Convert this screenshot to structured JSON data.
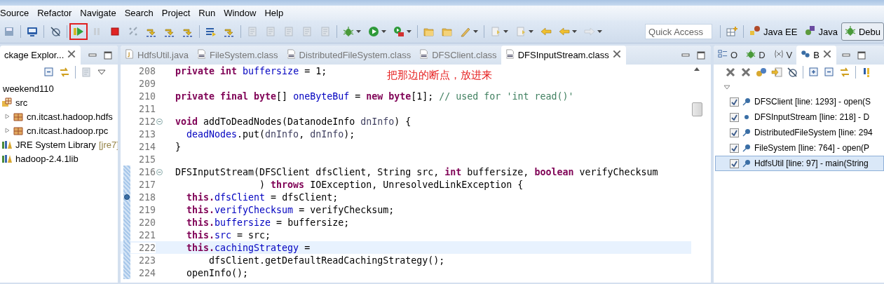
{
  "menu": [
    "Source",
    "Refactor",
    "Navigate",
    "Search",
    "Project",
    "Run",
    "Window",
    "Help"
  ],
  "toolbar": [
    {
      "kind": "disk"
    },
    {
      "kind": "sep"
    },
    {
      "kind": "monitor"
    },
    {
      "kind": "sep"
    },
    {
      "kind": "skip"
    },
    {
      "kind": "sep"
    },
    {
      "kind": "resume",
      "highlighted": true
    },
    {
      "kind": "pause"
    },
    {
      "kind": "stop"
    },
    {
      "kind": "unlink"
    },
    {
      "kind": "step"
    },
    {
      "kind": "step"
    },
    {
      "kind": "step"
    },
    {
      "kind": "sep"
    },
    {
      "kind": "list"
    },
    {
      "kind": "step"
    },
    {
      "kind": "sep"
    },
    {
      "kind": "gray"
    },
    {
      "kind": "gray"
    },
    {
      "kind": "gray"
    },
    {
      "kind": "gray"
    },
    {
      "kind": "gray"
    },
    {
      "kind": "sep"
    },
    {
      "kind": "bug",
      "dropdown": true
    },
    {
      "kind": "run",
      "dropdown": true
    },
    {
      "kind": "tools",
      "dropdown": true
    },
    {
      "kind": "sep"
    },
    {
      "kind": "folder"
    },
    {
      "kind": "folder"
    },
    {
      "kind": "pencil",
      "dropdown": true
    },
    {
      "kind": "sep"
    },
    {
      "kind": "page",
      "dropdown": true
    },
    {
      "kind": "page",
      "dropdown": true
    },
    {
      "kind": "back"
    },
    {
      "kind": "back",
      "dropdown": true
    },
    {
      "kind": "forward",
      "dropdown": true
    }
  ],
  "quick_access": {
    "placeholder": "Quick Access"
  },
  "perspectives": [
    {
      "label": "Java EE",
      "selected": false
    },
    {
      "label": "Java",
      "selected": false
    },
    {
      "label": "Debu",
      "selected": true
    }
  ],
  "package_explorer": {
    "title": "ckage Explor...",
    "toolbar": [
      {
        "kind": "collapse"
      },
      {
        "kind": "sync"
      },
      {
        "kind": "sep"
      },
      {
        "kind": "gray"
      },
      {
        "kind": "menu"
      }
    ],
    "tree": [
      {
        "label": "weekend110",
        "children": [
          {
            "label": "src",
            "kind": "source",
            "children": [
              {
                "label": "cn.itcast.hadoop.hdfs",
                "kind": "package",
                "expanded": false
              },
              {
                "label": "cn.itcast.hadoop.rpc",
                "kind": "package",
                "expanded": false
              }
            ]
          },
          {
            "label": "JRE System Library",
            "decoration": "[jre7]",
            "kind": "library"
          },
          {
            "label": "hadoop-2.4.1lib",
            "kind": "library"
          }
        ]
      }
    ]
  },
  "editor": {
    "tabs": [
      {
        "label": "HdfsUtil.java",
        "kind": "java",
        "selected": false
      },
      {
        "label": "FileSystem.class",
        "kind": "class",
        "selected": false
      },
      {
        "label": "DistributedFileSystem.class",
        "kind": "class",
        "selected": false
      },
      {
        "label": "DFSClient.class",
        "kind": "class",
        "selected": false
      },
      {
        "label": "DFSInputStream.class",
        "kind": "class",
        "selected": true
      }
    ],
    "note": "把那边的断点，放进来",
    "lines": [
      {
        "number": "208",
        "segments": [
          {
            "kind": "keyword",
            "text": "private int "
          },
          {
            "kind": "field",
            "text": "buffersize"
          },
          {
            "kind": "plain",
            "text": " = 1;"
          }
        ]
      },
      {
        "number": "209"
      },
      {
        "number": "210",
        "segments": [
          {
            "kind": "keyword",
            "text": "private final byte"
          },
          {
            "kind": "plain",
            "text": "[] "
          },
          {
            "kind": "field",
            "text": "oneByteBuf"
          },
          {
            "kind": "plain",
            "text": " = "
          },
          {
            "kind": "keyword",
            "text": "new byte"
          },
          {
            "kind": "plain",
            "text": "[1]; "
          },
          {
            "kind": "comment",
            "text": "// used for 'int read()'"
          }
        ]
      },
      {
        "number": "211"
      },
      {
        "number": "212",
        "fold": true,
        "segments": [
          {
            "kind": "keyword",
            "text": "void"
          },
          {
            "kind": "plain",
            "text": " addToDeadNodes(DatanodeInfo "
          },
          {
            "kind": "param",
            "text": "dnInfo"
          },
          {
            "kind": "plain",
            "text": ") {"
          }
        ]
      },
      {
        "number": "213",
        "segments": [
          {
            "kind": "field",
            "text": "  deadNodes"
          },
          {
            "kind": "plain",
            "text": ".put("
          },
          {
            "kind": "param",
            "text": "dnInfo"
          },
          {
            "kind": "plain",
            "text": ", "
          },
          {
            "kind": "param",
            "text": "dnInfo"
          },
          {
            "kind": "plain",
            "text": ");"
          }
        ]
      },
      {
        "number": "214",
        "segments": [
          {
            "kind": "plain",
            "text": "}"
          }
        ]
      },
      {
        "number": "215"
      },
      {
        "number": "216",
        "fold": true,
        "segments": [
          {
            "kind": "plain",
            "text": "DFSInputStream(DFSClient dfsClient, String src, "
          },
          {
            "kind": "keyword",
            "text": "int"
          },
          {
            "kind": "plain",
            "text": " buffersize, "
          },
          {
            "kind": "keyword",
            "text": "boolean"
          },
          {
            "kind": "plain",
            "text": " verifyChecksum"
          }
        ]
      },
      {
        "number": "217",
        "segments": [
          {
            "kind": "plain",
            "text": "               ) "
          },
          {
            "kind": "keyword",
            "text": "throws"
          },
          {
            "kind": "plain",
            "text": " IOException, UnresolvedLinkException {"
          }
        ]
      },
      {
        "number": "218",
        "breakpoint": true,
        "segments": [
          {
            "kind": "keyword",
            "text": "  this."
          },
          {
            "kind": "field",
            "text": "dfsClient"
          },
          {
            "kind": "plain",
            "text": " = dfsClient;"
          }
        ]
      },
      {
        "number": "219",
        "segments": [
          {
            "kind": "keyword",
            "text": "  this."
          },
          {
            "kind": "field",
            "text": "verifyChecksum"
          },
          {
            "kind": "plain",
            "text": " = verifyChecksum;"
          }
        ]
      },
      {
        "number": "220",
        "segments": [
          {
            "kind": "keyword",
            "text": "  this."
          },
          {
            "kind": "field",
            "text": "buffersize"
          },
          {
            "kind": "plain",
            "text": " = buffersize;"
          }
        ]
      },
      {
        "number": "221",
        "segments": [
          {
            "kind": "keyword",
            "text": "  this."
          },
          {
            "kind": "field",
            "text": "src"
          },
          {
            "kind": "plain",
            "text": " = src;"
          }
        ]
      },
      {
        "number": "222",
        "current": true,
        "segments": [
          {
            "kind": "keyword",
            "text": "  this."
          },
          {
            "kind": "field",
            "text": "cachingStrategy"
          },
          {
            "kind": "plain",
            "text": " ="
          }
        ]
      },
      {
        "number": "223",
        "segments": [
          {
            "kind": "plain",
            "text": "      dfsClient.getDefaultReadCachingStrategy();"
          }
        ]
      },
      {
        "number": "224",
        "segments": [
          {
            "kind": "plain",
            "text": "  openInfo();"
          }
        ]
      }
    ]
  },
  "right_panel": {
    "tabs": [
      {
        "label": "O",
        "kind": "outline",
        "selected": false
      },
      {
        "label": "D",
        "kind": "debug",
        "selected": false
      },
      {
        "label": "V",
        "kind": "variables",
        "selected": false
      },
      {
        "label": "B",
        "kind": "breakpoints",
        "selected": true
      }
    ],
    "toolbar": [
      {
        "kind": "remove"
      },
      {
        "kind": "remove"
      },
      {
        "kind": "link"
      },
      {
        "kind": "import"
      },
      {
        "kind": "skip"
      },
      {
        "kind": "sep"
      },
      {
        "kind": "expand"
      },
      {
        "kind": "collapse"
      },
      {
        "kind": "sync"
      },
      {
        "kind": "sep"
      },
      {
        "kind": "warn"
      }
    ],
    "breakpoints": [
      {
        "label": "DFSClient [line: 1293] - open(S",
        "checked": true,
        "kind": "line",
        "selected": false
      },
      {
        "label": "DFSInputStream [line: 218] - D",
        "checked": true,
        "kind": "dot",
        "selected": false
      },
      {
        "label": "DistributedFileSystem [line: 294",
        "checked": true,
        "kind": "line",
        "selected": false
      },
      {
        "label": "FileSystem [line: 764] - open(P",
        "checked": true,
        "kind": "line",
        "selected": false
      },
      {
        "label": "HdfsUtil [line: 97] - main(String",
        "checked": true,
        "kind": "line",
        "selected": true
      }
    ]
  }
}
